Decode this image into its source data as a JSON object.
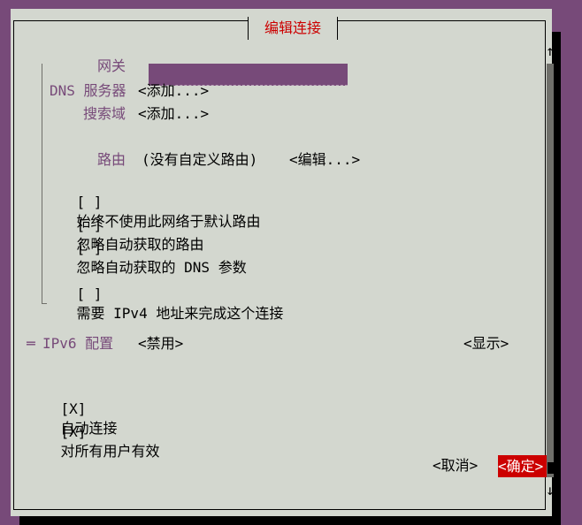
{
  "dialog": {
    "title": "编辑连接"
  },
  "scroll": {
    "up": "↑",
    "down": "↓"
  },
  "ipv4": {
    "gateway_label": "网关",
    "gateway_value": "",
    "dns_label": "DNS 服务器",
    "dns_add": "<添加...>",
    "search_label": "搜索域",
    "search_add": "<添加...>",
    "routing_label": "路由",
    "routing_value": "(没有自定义路由)",
    "routing_edit": "<编辑...>",
    "check_never_default": {
      "mark": "[ ]",
      "label": "始终不使用此网络于默认路由"
    },
    "check_ignore_routes": {
      "mark": "[ ]",
      "label": "忽略自动获取的路由"
    },
    "check_ignore_dns": {
      "mark": "[ ]",
      "label": "忽略自动获取的 DNS 参数"
    },
    "check_require_ipv4": {
      "mark": "[ ]",
      "label": "需要 IPv4 地址来完成这个连接"
    }
  },
  "ipv6": {
    "marker": "═",
    "label": "IPv6 配置",
    "mode": "<禁用>",
    "show": "<显示>"
  },
  "options": {
    "auto_connect": {
      "mark": "[X]",
      "label": "自动连接"
    },
    "all_users": {
      "mark": "[X]",
      "label": "对所有用户有效"
    }
  },
  "buttons": {
    "cancel": "<取消>",
    "ok": "<确定>"
  },
  "colors": {
    "background": "#774a79",
    "dialog": "#d3d7cf",
    "accent": "#cc0000",
    "label": "#774a79"
  }
}
